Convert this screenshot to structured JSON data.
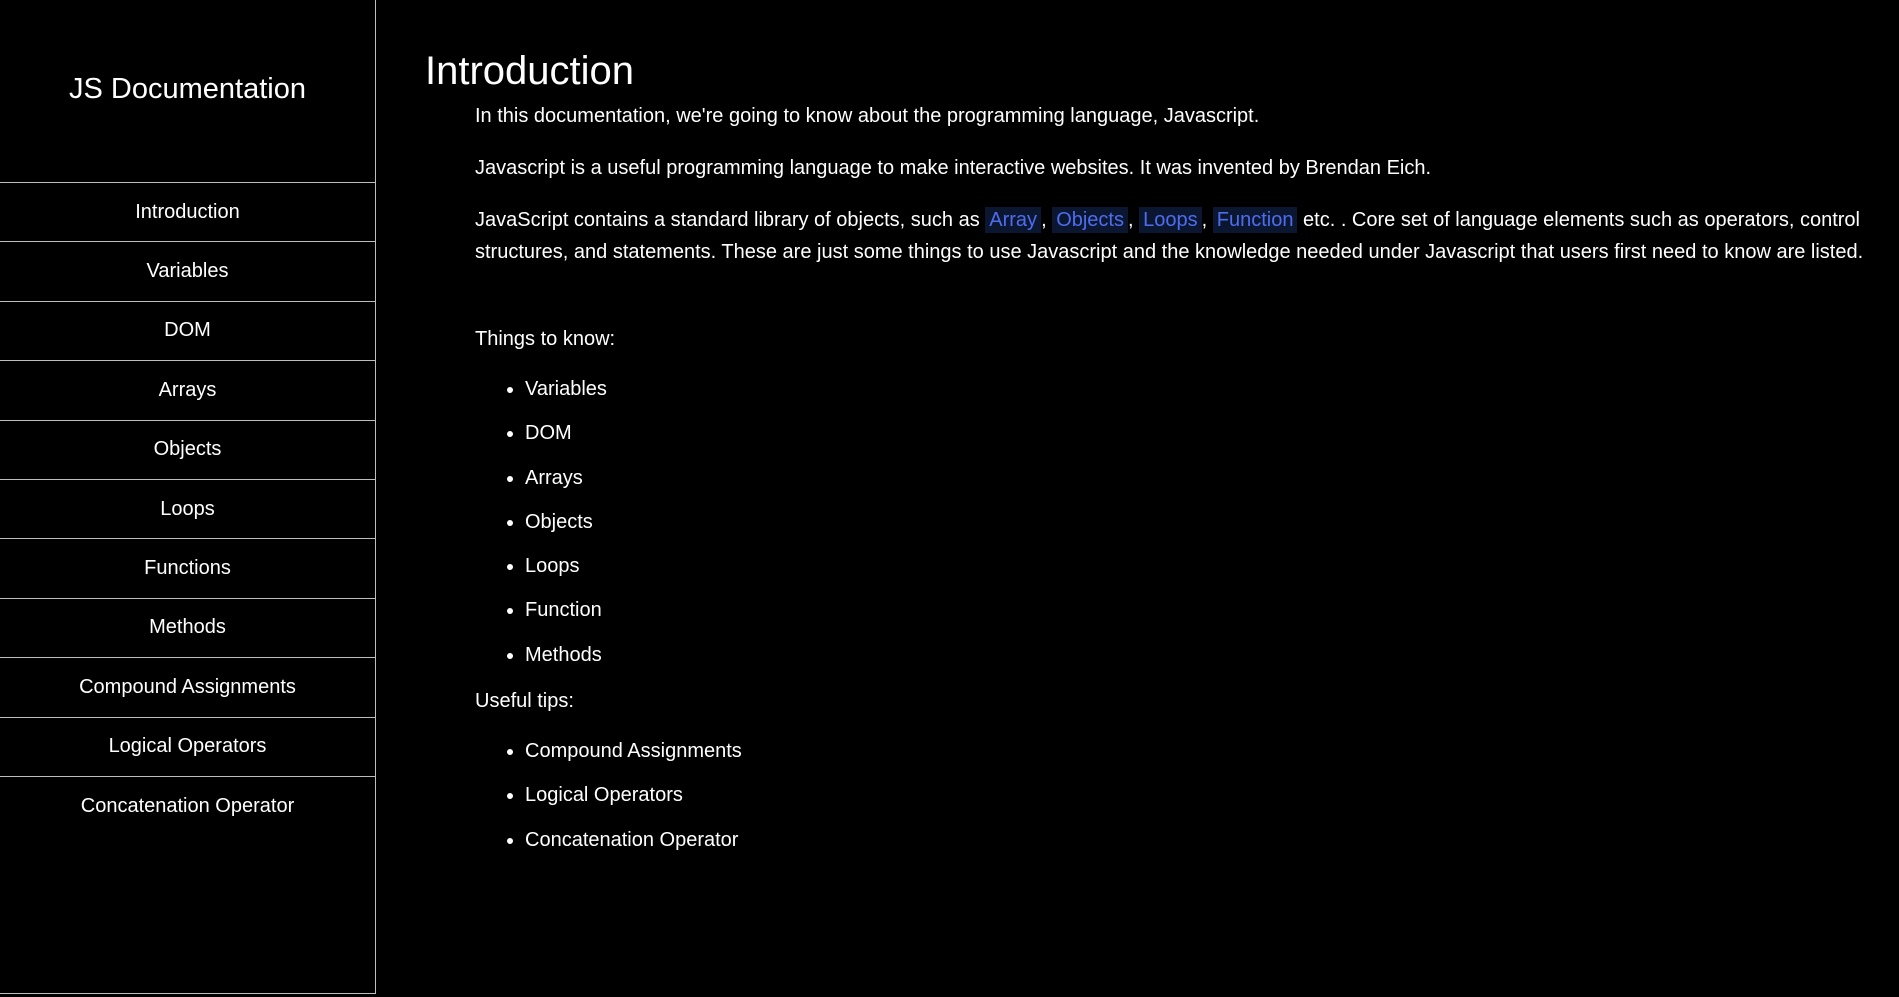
{
  "navbar": {
    "title": "JS Documentation",
    "links": [
      "Introduction",
      "Variables",
      "DOM",
      "Arrays",
      "Objects",
      "Loops",
      "Functions",
      "Methods",
      "Compound Assignments",
      "Logical Operators",
      "Concatenation Operator"
    ]
  },
  "section": {
    "title": "Introduction",
    "p1": "In this documentation, we're going to know about the programming language, Javascript.",
    "p2": "Javascript is a useful programming language to make interactive websites. It was invented by Brendan Eich.",
    "p3_before": "JavaScript contains a standard library of objects, such as ",
    "codes": [
      "Array",
      "Objects",
      "Loops",
      "Function"
    ],
    "sep": ", ",
    "p3_after": " etc. . Core set of language elements such as operators, control structures, and statements. These are just some things to use Javascript and the knowledge needed under Javascript that users first need to know are listed.",
    "things_label": "Things to know:",
    "things": [
      "Variables",
      "DOM",
      "Arrays",
      "Objects",
      "Loops",
      "Function",
      "Methods"
    ],
    "tips_label": "Useful tips:",
    "tips": [
      "Compound Assignments",
      "Logical Operators",
      "Concatenation Operator"
    ]
  },
  "colors": {
    "background": "#000000",
    "text": "#ffffff",
    "code_text": "#4f6cf0",
    "code_background": "#0b1730",
    "border": "#bdbdbd"
  }
}
